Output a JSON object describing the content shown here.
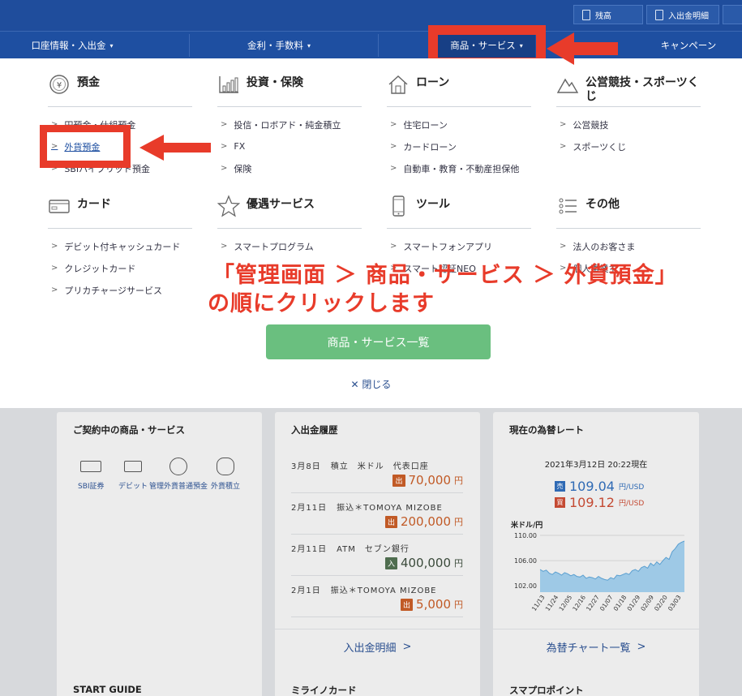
{
  "topbar": {
    "balance_label": "残高",
    "statement_label": "入出金明細"
  },
  "nav": {
    "items": [
      {
        "label": "口座情報・入出金",
        "caret": "▾"
      },
      {
        "label": "金利・手数料",
        "caret": "▾"
      },
      {
        "label": "商品・サービス",
        "caret": "▾"
      },
      {
        "label": "キャンペーン"
      }
    ]
  },
  "menu": {
    "columns": [
      {
        "title": "預金",
        "icon": "yen-coin-icon",
        "links": [
          "円預金・仕組預金",
          "外貨預金",
          "SBIハイブリッド預金"
        ]
      },
      {
        "title": "投資・保険",
        "icon": "bar-chart-icon",
        "links": [
          "投信・ロボアド・純金積立",
          "FX",
          "保険"
        ]
      },
      {
        "title": "ローン",
        "icon": "house-icon",
        "links": [
          "住宅ローン",
          "カードローン",
          "自動車・教育・不動産担保他"
        ]
      },
      {
        "title": "公営競技・スポーツくじ",
        "icon": "mountain-icon",
        "links": [
          "公営競技",
          "スポーツくじ"
        ]
      },
      {
        "title": "カード",
        "icon": "card-icon",
        "links": [
          "デビット付キャッシュカード",
          "クレジットカード",
          "プリカチャージサービス"
        ]
      },
      {
        "title": "優遇サービス",
        "icon": "star-icon",
        "links": [
          "スマートプログラム"
        ]
      },
      {
        "title": "ツール",
        "icon": "smartphone-icon",
        "links": [
          "スマートフォンアプリ",
          "スマート認証NEO"
        ]
      },
      {
        "title": "その他",
        "icon": "list-icon",
        "links": [
          "法人のお客さま",
          "個人事業主"
        ]
      }
    ],
    "button_label": "商品・サービス一覧",
    "close_label": "閉じる",
    "close_icon": "close-icon"
  },
  "annotation": {
    "line1": "「管理画面 ＞ 商品・サービス ＞ 外貨預金」",
    "line2": "の順にクリックします",
    "color": "#e83b2a"
  },
  "cards": {
    "contracts": {
      "title": "ご契約中の商品・サービス",
      "products": [
        "SBI証券",
        "デビット",
        "管理外貨普通預金",
        "外貨積立"
      ]
    },
    "history": {
      "title": "入出金履歴",
      "rows": [
        {
          "date": "3月8日",
          "desc": "積立　米ドル　代表口座",
          "type": "出",
          "amount": "70,000",
          "unit": "円"
        },
        {
          "date": "2月11日",
          "desc": "振込＊TOMOYA MIZOBE",
          "type": "出",
          "amount": "200,000",
          "unit": "円"
        },
        {
          "date": "2月11日",
          "desc": "ATM　セブン銀行",
          "type": "入",
          "amount": "400,000",
          "unit": "円"
        },
        {
          "date": "2月1日",
          "desc": "振込＊TOMOYA MIZOBE",
          "type": "出",
          "amount": "5,000",
          "unit": "円"
        }
      ],
      "footer": "入出金明細"
    },
    "fx": {
      "title": "現在の為替レート",
      "timestamp": "2021年3月12日 20:22現在",
      "sell_tag": "売",
      "sell_value": "109.04",
      "buy_tag": "買",
      "buy_value": "109.12",
      "unit": "円/USD",
      "footer": "為替チャート一覧"
    },
    "bottom": [
      "START GUIDE",
      "ミライノカード",
      "スマプロポイント"
    ]
  },
  "chart_data": {
    "type": "area",
    "title": "",
    "ylabel": "米ドル/円",
    "ylim": [
      101,
      110
    ],
    "yticks": [
      "110.00",
      "106.00",
      "102.00"
    ],
    "xticks": [
      "11/13",
      "11/24",
      "12/05",
      "12/16",
      "12/27",
      "01/07",
      "01/18",
      "01/29",
      "02/09",
      "02/20",
      "03/03"
    ],
    "values": [
      104.6,
      104.3,
      104.5,
      104.0,
      103.8,
      104.2,
      104.0,
      103.7,
      104.1,
      103.9,
      103.6,
      103.8,
      103.5,
      103.4,
      103.7,
      103.2,
      103.4,
      103.3,
      103.1,
      103.5,
      103.2,
      103.0,
      102.9,
      103.3,
      103.1,
      103.7,
      103.6,
      103.8,
      104.0,
      103.8,
      104.4,
      104.6,
      104.3,
      104.9,
      105.1,
      104.8,
      105.6,
      105.2,
      105.8,
      105.4,
      106.0,
      106.5,
      106.2,
      107.4,
      107.9,
      108.6,
      108.9,
      109.1
    ]
  },
  "colors": {
    "nav_bg": "#1e4fa1",
    "accent_red": "#e83b2a",
    "button_green": "#6abf7f",
    "chart_fill": "#9ec9e6"
  }
}
